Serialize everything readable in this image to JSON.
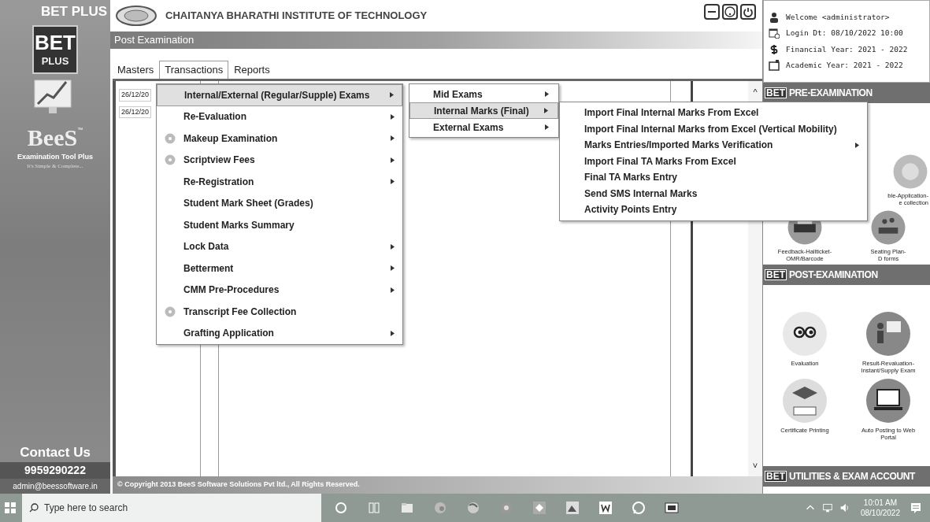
{
  "sidebar": {
    "brand": "BET PLUS",
    "logo_main": "BET",
    "logo_sub": "PLUS",
    "product": "BeeS",
    "product_mark": "™",
    "tagline": "Examination Tool Plus",
    "slogan": "It's Simple & Complete...",
    "contact_title": "Contact Us",
    "phone": "9959290222",
    "email": "admin@beessoftware.in"
  },
  "header": {
    "title": "CHAITANYA BHARATHI INSTITUTE OF TECHNOLOGY",
    "module": "Post Examination"
  },
  "menubar": [
    {
      "label": "Masters",
      "selected": false
    },
    {
      "label": "Transactions",
      "selected": true
    },
    {
      "label": "Reports",
      "selected": false
    }
  ],
  "rows": [
    {
      "date": "26/12/20"
    },
    {
      "date": "26/12/20"
    }
  ],
  "footer": "© Copyright 2013 BeeS Software Solutions Pvt ltd., All Rights Reserved.",
  "scroll": {
    "up": "^",
    "down": "˅"
  },
  "menu": [
    {
      "label": "Internal/External (Regular/Supple) Exams",
      "selected": true,
      "icon": false,
      "submenu": true
    },
    {
      "label": "Re-Evaluation",
      "selected": false,
      "icon": false,
      "submenu": true
    },
    {
      "label": "Makeup Examination",
      "selected": false,
      "icon": true,
      "submenu": true
    },
    {
      "label": "Scriptview Fees",
      "selected": false,
      "icon": true,
      "submenu": true
    },
    {
      "label": "Re-Registration",
      "selected": false,
      "icon": false,
      "submenu": true
    },
    {
      "label": "Student Mark Sheet (Grades)",
      "selected": false,
      "icon": false,
      "submenu": false
    },
    {
      "label": "Student Marks Summary",
      "selected": false,
      "icon": false,
      "submenu": false
    },
    {
      "label": "Lock Data",
      "selected": false,
      "icon": false,
      "submenu": true
    },
    {
      "label": "Betterment",
      "selected": false,
      "icon": false,
      "submenu": true
    },
    {
      "label": "CMM Pre-Procedures",
      "selected": false,
      "icon": false,
      "submenu": true
    },
    {
      "label": "Transcript Fee Collection",
      "selected": false,
      "icon": true,
      "submenu": false
    },
    {
      "label": "Grafting Application",
      "selected": false,
      "icon": false,
      "submenu": true
    }
  ],
  "submenu": [
    {
      "label": "Mid Exams",
      "selected": false,
      "submenu": true
    },
    {
      "label": "Internal Marks (Final)",
      "selected": true,
      "submenu": true
    },
    {
      "label": "External Exams",
      "selected": false,
      "submenu": true
    }
  ],
  "submenu2": [
    {
      "label": "Import Final Internal Marks From Excel",
      "submenu": false
    },
    {
      "label": "Import Final Internal Marks from Excel (Vertical Mobility)",
      "submenu": false
    },
    {
      "label": "Marks Entries/Imported Marks Verification",
      "submenu": true
    },
    {
      "label": "Import Final TA Marks From Excel",
      "submenu": false
    },
    {
      "label": "Final TA Marks Entry",
      "submenu": false
    },
    {
      "label": "Send SMS Internal Marks",
      "submenu": false
    },
    {
      "label": "Activity Points Entry",
      "submenu": false
    }
  ],
  "info": [
    "Welcome <administrator>",
    "Login Dt: 08/10/2022 10:00",
    "Financial Year: 2021 - 2022",
    "Academic Year: 2021 - 2022"
  ],
  "sections": [
    {
      "badge": "BET",
      "title": "PRE-EXAMINATION",
      "tiles": [
        {
          "caption": "ble-Application-\ne collection"
        },
        {
          "caption": "Feedback-Hallticket-\nOMR/Barcode"
        },
        {
          "caption": "Seating Plan-\nD forms"
        }
      ]
    },
    {
      "badge": "BET",
      "title": "POST-EXAMINATION",
      "tiles": [
        {
          "caption": "Evaluation"
        },
        {
          "caption": "Result-Revaluation-\nInstant/Supply Exam"
        },
        {
          "caption": "Certificate Printing"
        },
        {
          "caption": "Auto Posting to Web\nPortal"
        }
      ]
    },
    {
      "badge": "BET",
      "title": "UTILITIES & EXAM ACCOUNT"
    }
  ],
  "taskbar": {
    "search_placeholder": "Type here to search",
    "time": "10:01 AM",
    "date": "08/10/2022"
  }
}
